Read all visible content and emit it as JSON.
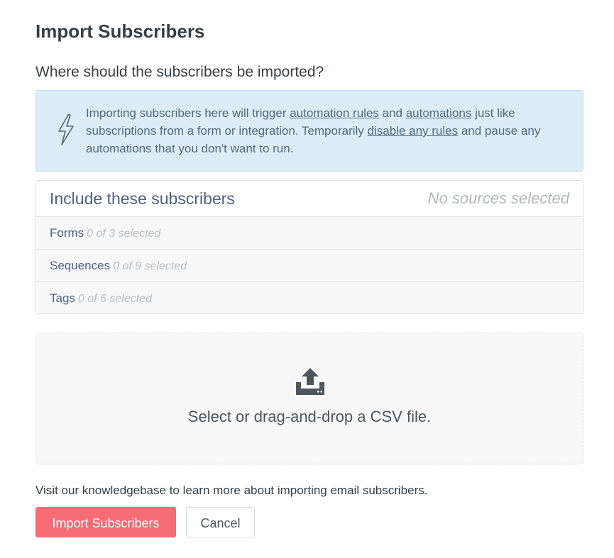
{
  "page": {
    "title": "Import Subscribers",
    "subheading": "Where should the subscribers be imported?"
  },
  "info": {
    "icon": "lightning-bolt-icon",
    "text_1": "Importing subscribers here will trigger ",
    "link_automation_rules": "automation rules",
    "text_2": " and ",
    "link_automations": "automations",
    "text_3": " just like subscriptions from a form or integration. Temporarily ",
    "link_disable_rules": "disable any rules",
    "text_4": " and pause any automations that you don't want to run."
  },
  "sources": {
    "title": "Include these subscribers",
    "status": "No sources selected",
    "rows": [
      {
        "label": "Forms",
        "count": "0 of 3 selected"
      },
      {
        "label": "Sequences",
        "count": "0 of 9 selected"
      },
      {
        "label": "Tags",
        "count": "0 of 6 selected"
      }
    ]
  },
  "dropzone": {
    "icon": "upload-icon",
    "text": "Select or drag-and-drop a CSV file."
  },
  "footer": {
    "note": "Visit our knowledgebase to learn more about importing email subscribers.",
    "import_label": "Import Subscribers",
    "cancel_label": "Cancel"
  },
  "colors": {
    "primary": "#f66c74",
    "info_bg": "#dcedf7",
    "heading_blue": "#4e5f8a"
  }
}
